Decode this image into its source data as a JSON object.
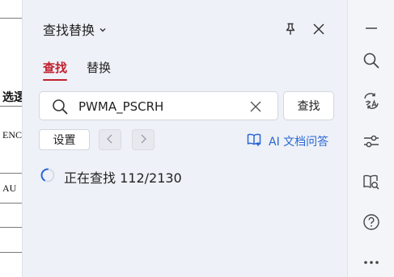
{
  "document": {
    "fragments": [
      "选逻",
      "ENC",
      "AU"
    ]
  },
  "panel": {
    "title": "查找替换",
    "tabs": {
      "find": "查找",
      "replace": "替换"
    },
    "search": {
      "value": "PWMA_PSCRH"
    },
    "find_button": "查找",
    "settings_button": "设置",
    "ai_link": "AI 文档问答",
    "status": "正在查找 112/2130"
  },
  "colors": {
    "accent_red": "#c2202e",
    "link_blue": "#2b67d4",
    "panel_bg": "#eef1f7"
  },
  "toolbar": {
    "icons": [
      "minimize-icon",
      "search-icon",
      "translate-icon",
      "filter-icon",
      "reader-icon",
      "help-icon",
      "more-icon"
    ]
  }
}
